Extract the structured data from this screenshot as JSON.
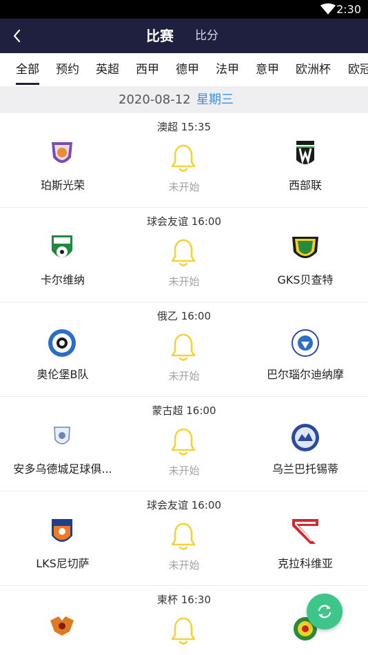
{
  "status_bar": {
    "time": "2:30",
    "icons": [
      "wifi-icon"
    ]
  },
  "header": {
    "title": "比赛",
    "subtitle": "比分",
    "back_icon": "back-chevron-icon"
  },
  "tabs": [
    {
      "label": "全部",
      "active": true
    },
    {
      "label": "预约"
    },
    {
      "label": "英超"
    },
    {
      "label": "西甲"
    },
    {
      "label": "德甲"
    },
    {
      "label": "法甲"
    },
    {
      "label": "意甲"
    },
    {
      "label": "欧洲杯"
    },
    {
      "label": "欧冠"
    }
  ],
  "date_bar": {
    "date": "2020-08-12",
    "weekday": "星期三"
  },
  "matches": [
    {
      "league_time": "澳超 15:35",
      "home": "珀斯光荣",
      "away": "西部联",
      "status": "未开始"
    },
    {
      "league_time": "球会友谊 16:00",
      "home": "卡尔维纳",
      "away": "GKS贝查特",
      "status": "未开始"
    },
    {
      "league_time": "俄乙 16:00",
      "home": "奥伦堡B队",
      "away": "巴尔瑙尔迪纳摩",
      "status": "未开始"
    },
    {
      "league_time": "蒙古超 16:00",
      "home": "安多乌德城足球俱...",
      "away": "乌兰巴托锡蒂",
      "status": "未开始"
    },
    {
      "league_time": "球会友谊 16:00",
      "home": "LKS尼切萨",
      "away": "克拉科维亚",
      "status": "未开始"
    },
    {
      "league_time": "柬杯 16:30",
      "home": "",
      "away": "",
      "status": ""
    }
  ],
  "colors": {
    "navbar": "#1f2040",
    "accent_blue": "#3d8fe0",
    "bell_yellow": "#f5d13a",
    "fab_green": "#3ec58a"
  },
  "fab": {
    "icon": "refresh-icon"
  }
}
